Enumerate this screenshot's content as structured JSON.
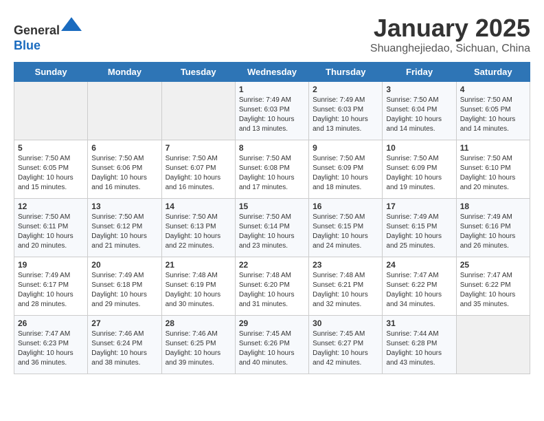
{
  "header": {
    "logo_line1": "General",
    "logo_line2": "Blue",
    "title": "January 2025",
    "subtitle": "Shuanghejiedao, Sichuan, China"
  },
  "weekdays": [
    "Sunday",
    "Monday",
    "Tuesday",
    "Wednesday",
    "Thursday",
    "Friday",
    "Saturday"
  ],
  "weeks": [
    [
      {
        "day": "",
        "info": ""
      },
      {
        "day": "",
        "info": ""
      },
      {
        "day": "",
        "info": ""
      },
      {
        "day": "1",
        "info": "Sunrise: 7:49 AM\nSunset: 6:03 PM\nDaylight: 10 hours and 13 minutes."
      },
      {
        "day": "2",
        "info": "Sunrise: 7:49 AM\nSunset: 6:03 PM\nDaylight: 10 hours and 13 minutes."
      },
      {
        "day": "3",
        "info": "Sunrise: 7:50 AM\nSunset: 6:04 PM\nDaylight: 10 hours and 14 minutes."
      },
      {
        "day": "4",
        "info": "Sunrise: 7:50 AM\nSunset: 6:05 PM\nDaylight: 10 hours and 14 minutes."
      }
    ],
    [
      {
        "day": "5",
        "info": "Sunrise: 7:50 AM\nSunset: 6:05 PM\nDaylight: 10 hours and 15 minutes."
      },
      {
        "day": "6",
        "info": "Sunrise: 7:50 AM\nSunset: 6:06 PM\nDaylight: 10 hours and 16 minutes."
      },
      {
        "day": "7",
        "info": "Sunrise: 7:50 AM\nSunset: 6:07 PM\nDaylight: 10 hours and 16 minutes."
      },
      {
        "day": "8",
        "info": "Sunrise: 7:50 AM\nSunset: 6:08 PM\nDaylight: 10 hours and 17 minutes."
      },
      {
        "day": "9",
        "info": "Sunrise: 7:50 AM\nSunset: 6:09 PM\nDaylight: 10 hours and 18 minutes."
      },
      {
        "day": "10",
        "info": "Sunrise: 7:50 AM\nSunset: 6:09 PM\nDaylight: 10 hours and 19 minutes."
      },
      {
        "day": "11",
        "info": "Sunrise: 7:50 AM\nSunset: 6:10 PM\nDaylight: 10 hours and 20 minutes."
      }
    ],
    [
      {
        "day": "12",
        "info": "Sunrise: 7:50 AM\nSunset: 6:11 PM\nDaylight: 10 hours and 20 minutes."
      },
      {
        "day": "13",
        "info": "Sunrise: 7:50 AM\nSunset: 6:12 PM\nDaylight: 10 hours and 21 minutes."
      },
      {
        "day": "14",
        "info": "Sunrise: 7:50 AM\nSunset: 6:13 PM\nDaylight: 10 hours and 22 minutes."
      },
      {
        "day": "15",
        "info": "Sunrise: 7:50 AM\nSunset: 6:14 PM\nDaylight: 10 hours and 23 minutes."
      },
      {
        "day": "16",
        "info": "Sunrise: 7:50 AM\nSunset: 6:15 PM\nDaylight: 10 hours and 24 minutes."
      },
      {
        "day": "17",
        "info": "Sunrise: 7:49 AM\nSunset: 6:15 PM\nDaylight: 10 hours and 25 minutes."
      },
      {
        "day": "18",
        "info": "Sunrise: 7:49 AM\nSunset: 6:16 PM\nDaylight: 10 hours and 26 minutes."
      }
    ],
    [
      {
        "day": "19",
        "info": "Sunrise: 7:49 AM\nSunset: 6:17 PM\nDaylight: 10 hours and 28 minutes."
      },
      {
        "day": "20",
        "info": "Sunrise: 7:49 AM\nSunset: 6:18 PM\nDaylight: 10 hours and 29 minutes."
      },
      {
        "day": "21",
        "info": "Sunrise: 7:48 AM\nSunset: 6:19 PM\nDaylight: 10 hours and 30 minutes."
      },
      {
        "day": "22",
        "info": "Sunrise: 7:48 AM\nSunset: 6:20 PM\nDaylight: 10 hours and 31 minutes."
      },
      {
        "day": "23",
        "info": "Sunrise: 7:48 AM\nSunset: 6:21 PM\nDaylight: 10 hours and 32 minutes."
      },
      {
        "day": "24",
        "info": "Sunrise: 7:47 AM\nSunset: 6:22 PM\nDaylight: 10 hours and 34 minutes."
      },
      {
        "day": "25",
        "info": "Sunrise: 7:47 AM\nSunset: 6:22 PM\nDaylight: 10 hours and 35 minutes."
      }
    ],
    [
      {
        "day": "26",
        "info": "Sunrise: 7:47 AM\nSunset: 6:23 PM\nDaylight: 10 hours and 36 minutes."
      },
      {
        "day": "27",
        "info": "Sunrise: 7:46 AM\nSunset: 6:24 PM\nDaylight: 10 hours and 38 minutes."
      },
      {
        "day": "28",
        "info": "Sunrise: 7:46 AM\nSunset: 6:25 PM\nDaylight: 10 hours and 39 minutes."
      },
      {
        "day": "29",
        "info": "Sunrise: 7:45 AM\nSunset: 6:26 PM\nDaylight: 10 hours and 40 minutes."
      },
      {
        "day": "30",
        "info": "Sunrise: 7:45 AM\nSunset: 6:27 PM\nDaylight: 10 hours and 42 minutes."
      },
      {
        "day": "31",
        "info": "Sunrise: 7:44 AM\nSunset: 6:28 PM\nDaylight: 10 hours and 43 minutes."
      },
      {
        "day": "",
        "info": ""
      }
    ]
  ]
}
